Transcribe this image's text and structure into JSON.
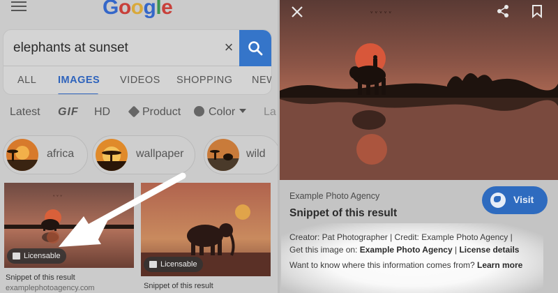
{
  "header": {
    "logo": [
      "G",
      "o",
      "o",
      "g",
      "l",
      "e"
    ]
  },
  "search": {
    "query": "elephants at sunset"
  },
  "tabs": [
    "ALL",
    "IMAGES",
    "VIDEOS",
    "SHOPPING",
    "NEWS"
  ],
  "filters": {
    "latest": "Latest",
    "gif": "GIF",
    "hd": "HD",
    "product": "Product",
    "color": "Color",
    "more": "La"
  },
  "chips": [
    "africa",
    "wallpaper",
    "wild"
  ],
  "results": [
    {
      "badge": "Licensable",
      "caption": "Snippet of this result",
      "source": "examplephotoagency.com"
    },
    {
      "badge": "Licensable",
      "caption": "Snippet of this result"
    }
  ],
  "detail": {
    "agency": "Example Photo Agency",
    "title": "Snippet of this result",
    "visit_label": "Visit",
    "creator_line": "Creator: Pat Photographer | Credit: Example Photo Agency |",
    "get_prefix": "Get this image on: ",
    "get_agency": "Example Photo Agency",
    "separator": " | ",
    "license_details": "License details",
    "info_question": "Want to know where this information comes from? ",
    "learn_more": "Learn more"
  },
  "colors": {
    "accent": "#2e63bc",
    "search_button": "#3575c9",
    "visit_button": "#2e6bbf"
  },
  "icons": [
    "menu-icon",
    "clear-icon",
    "search-icon",
    "close-icon",
    "share-icon",
    "bookmark-icon",
    "globe-icon",
    "image-icon",
    "tag-icon",
    "palette-icon"
  ]
}
